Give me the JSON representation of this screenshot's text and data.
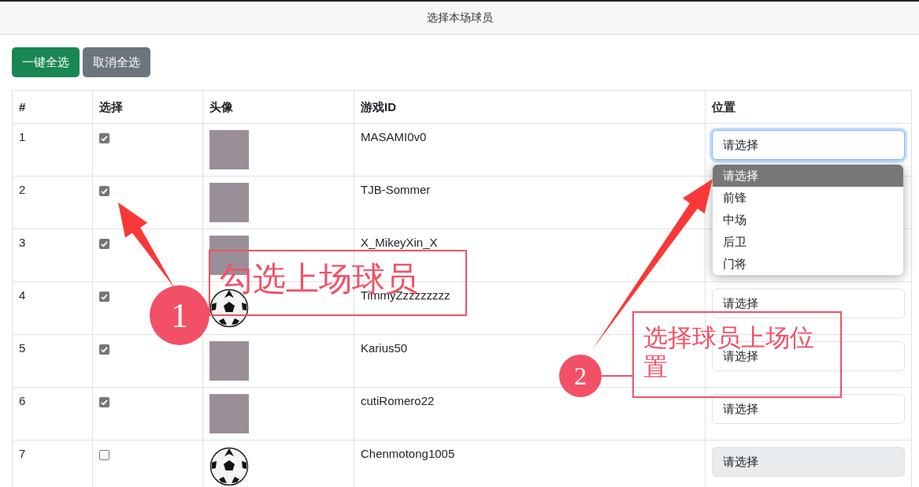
{
  "window": {
    "title": "选择本场球员"
  },
  "buttons": [
    {
      "label": "一键全选",
      "kind": "primary"
    },
    {
      "label": "取消全选",
      "kind": "secondary"
    }
  ],
  "table": {
    "columns": [
      "#",
      "选择",
      "头像",
      "游戏ID",
      "位置"
    ],
    "rows": [
      {
        "index": "1",
        "checked": true,
        "avatar": {
          "kind": "photo"
        },
        "game_id": "MASAMI0v0",
        "position": {
          "value": "请选择",
          "focused": true,
          "disabled": false
        }
      },
      {
        "index": "2",
        "checked": true,
        "avatar": {
          "kind": "photo"
        },
        "game_id": "TJB-Sommer"
      },
      {
        "index": "3",
        "checked": true,
        "avatar": {
          "kind": "photo"
        },
        "game_id": "X_MikeyXin_X"
      },
      {
        "index": "4",
        "checked": true,
        "avatar": {
          "kind": "ball"
        },
        "game_id": "TimmyZzzzzzzzz",
        "position": {
          "value": "请选择",
          "focused": false,
          "disabled": false
        }
      },
      {
        "index": "5",
        "checked": true,
        "avatar": {
          "kind": "photo"
        },
        "game_id": "Karius50",
        "position": {
          "value": "请选择",
          "focused": false,
          "disabled": false
        }
      },
      {
        "index": "6",
        "checked": true,
        "avatar": {
          "kind": "photo"
        },
        "game_id": "cutiRomero22",
        "position": {
          "value": "请选择",
          "focused": false,
          "disabled": false
        }
      },
      {
        "index": "7",
        "checked": false,
        "avatar": {
          "kind": "ball"
        },
        "game_id": "Chenmotong1005",
        "position": {
          "value": "请选择",
          "focused": false,
          "disabled": true
        }
      }
    ]
  },
  "dropdown": {
    "options": [
      {
        "label": "请选择",
        "selected": true
      },
      {
        "label": "前锋",
        "selected": false
      },
      {
        "label": "中场",
        "selected": false
      },
      {
        "label": "后卫",
        "selected": false
      },
      {
        "label": "门将",
        "selected": false
      }
    ]
  },
  "annotations": [
    {
      "number": "1",
      "text": "勾选上场球员"
    },
    {
      "number": "2",
      "text": "选择球员上场位置"
    }
  ]
}
